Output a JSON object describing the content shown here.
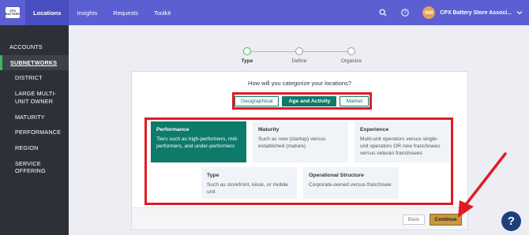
{
  "logo_text": "CPX BATTERY",
  "nav": {
    "items": [
      {
        "label": "Locations",
        "active": true
      },
      {
        "label": "Insights",
        "active": false
      },
      {
        "label": "Requests",
        "active": false
      },
      {
        "label": "Toolkit",
        "active": false
      }
    ],
    "avatar_initials": "NM",
    "store_name": "CPX Battery Store Associ..."
  },
  "sidebar": {
    "items": [
      {
        "label": "ACCOUNTS"
      },
      {
        "label": "SUBNETWORKS"
      },
      {
        "label": "DISTRICT"
      },
      {
        "label": "LARGE MULTI-UNIT OWNER"
      },
      {
        "label": "MATURITY"
      },
      {
        "label": "PERFORMANCE"
      },
      {
        "label": "REGION"
      },
      {
        "label": "SERVICE OFFERING"
      }
    ]
  },
  "stepper": {
    "steps": [
      {
        "label": "Type"
      },
      {
        "label": "Define"
      },
      {
        "label": "Organize"
      }
    ]
  },
  "question": "How will you categorize your locations?",
  "segments": [
    {
      "label": "Geographical"
    },
    {
      "label": "Age and Activity"
    },
    {
      "label": "Market"
    }
  ],
  "options": [
    {
      "title": "Performance",
      "desc": "Tiers such as high-performers, mid-performers, and under-performers"
    },
    {
      "title": "Maturity",
      "desc": "Such as new (startup) versus established (mature)"
    },
    {
      "title": "Experience",
      "desc": "Multi-unit operators versus single-unit operators OR new franchisees versus veteran franchisees"
    },
    {
      "title": "Type",
      "desc": "Such as storefront, kiosk, or mobile unit"
    },
    {
      "title": "Operational Structure",
      "desc": "Corporate-owned versus franchisee"
    }
  ],
  "footer": {
    "back_label": "Back",
    "continue_label": "Continue"
  },
  "help_label": "?",
  "colors": {
    "nav": "#5b5fd2",
    "sidebar": "#2d3137",
    "primary": "#0e7a6a",
    "continue": "#c8993e",
    "annotation": "#e01b24"
  }
}
